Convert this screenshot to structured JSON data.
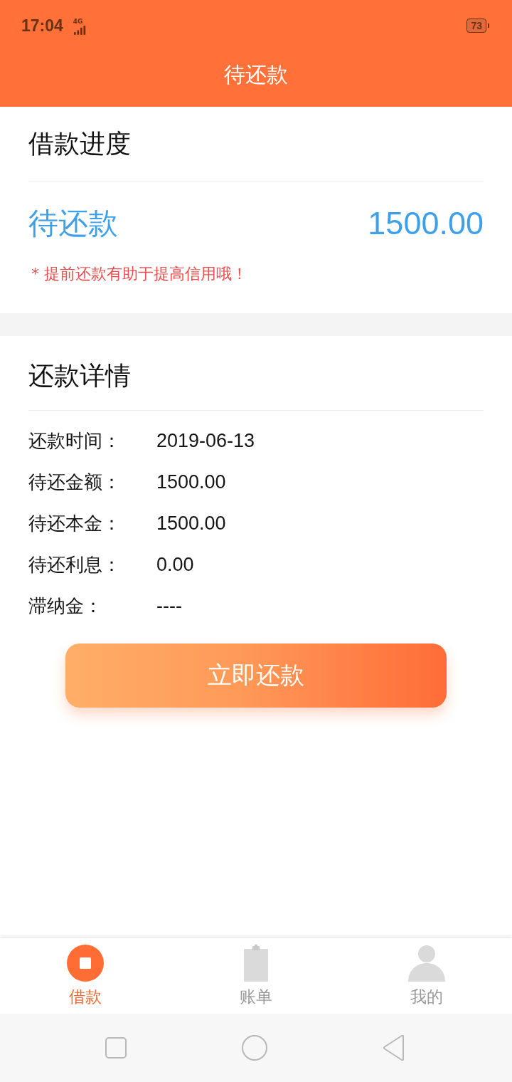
{
  "status_bar": {
    "time": "17:04",
    "network": "4G",
    "battery": "73"
  },
  "title": "待还款",
  "progress": {
    "heading": "借款进度",
    "status": "待还款",
    "amount": "1500.00",
    "note": "* 提前还款有助于提高信用哦！"
  },
  "details": {
    "heading": "还款详情",
    "rows": [
      {
        "label": "还款时间：",
        "value": "2019-06-13"
      },
      {
        "label": "待还金额：",
        "value": "1500.00"
      },
      {
        "label": "待还本金：",
        "value": "1500.00"
      },
      {
        "label": "待还利息：",
        "value": "0.00"
      },
      {
        "label": "滞纳金：",
        "value": "----"
      }
    ]
  },
  "pay_button": "立即还款",
  "tabs": [
    {
      "label": "借款",
      "kind": "loan",
      "selected": true
    },
    {
      "label": "账单",
      "kind": "bill",
      "selected": false
    },
    {
      "label": "我的",
      "kind": "profile",
      "selected": false
    }
  ]
}
